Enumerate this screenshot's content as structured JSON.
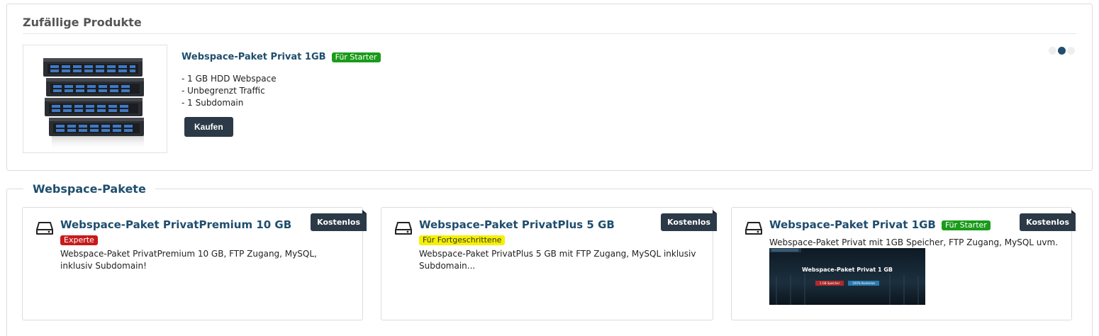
{
  "random_products": {
    "title": "Zufällige Produkte",
    "product": {
      "name": "Webspace-Paket Privat 1GB",
      "badge": "Für Starter",
      "features": [
        "- 1 GB HDD Webspace",
        "- Unbegrenzt Traffic",
        "- 1 Subdomain"
      ],
      "buy_label": "Kaufen",
      "image_icon": "server-rack-image"
    },
    "carousel": {
      "pages": 3,
      "active_index": 1
    }
  },
  "packages": {
    "title": "Webspace-Pakete",
    "items": [
      {
        "icon": "hard-drive-icon",
        "title": "Webspace-Paket PrivatPremium 10 GB",
        "badge": "Experte",
        "badge_color": "#c61b1b",
        "price_tag": "Kostenlos",
        "description": "Webspace-Paket PrivatPremium 10 GB, FTP Zugang, MySQL, inklusiv Subdomain!"
      },
      {
        "icon": "hard-drive-icon",
        "title": "Webspace-Paket PrivatPlus 5 GB",
        "badge": "Für Fortgeschrittene",
        "badge_color": "#f5f000",
        "price_tag": "Kostenlos",
        "description": "Webspace-Paket PrivatPlus 5 GB mit FTP Zugang, MySQL inklusiv Subdomain..."
      },
      {
        "icon": "hard-drive-icon",
        "title": "Webspace-Paket Privat 1GB",
        "badge": "Für Starter",
        "badge_color": "#1a9b1a",
        "price_tag": "Kostenlos",
        "description": "Webspace-Paket Privat mit 1GB Speicher, FTP Zugang, MySQL uvm.",
        "banner": {
          "title": "Webspace-Paket Privat 1 GB",
          "chip_1": "1 GB Speicher",
          "chip_2": "100% Kostenlos"
        }
      }
    ]
  },
  "colors": {
    "accent": "#1f4e6e",
    "dark": "#2b3a46",
    "green": "#1a9b1a",
    "red": "#c61b1b",
    "yellow": "#f5f000"
  }
}
